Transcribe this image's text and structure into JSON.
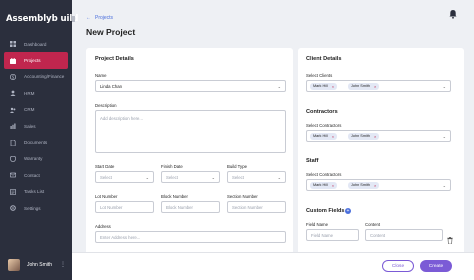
{
  "app": {
    "logo_text": "Assemblyb uild"
  },
  "sidebar": {
    "items": [
      {
        "label": "Dashboard",
        "icon": "dashboard-icon"
      },
      {
        "label": "Projects",
        "icon": "projects-icon",
        "active": true
      },
      {
        "label": "Accounting/Finance",
        "icon": "finance-icon"
      },
      {
        "label": "HRM",
        "icon": "hrm-icon"
      },
      {
        "label": "CRM",
        "icon": "crm-icon"
      },
      {
        "label": "Sales",
        "icon": "sales-icon"
      },
      {
        "label": "Documents",
        "icon": "documents-icon"
      },
      {
        "label": "Warranty",
        "icon": "warranty-icon"
      },
      {
        "label": "Contact",
        "icon": "contact-icon"
      },
      {
        "label": "Tasks List",
        "icon": "tasks-icon"
      },
      {
        "label": "Settings",
        "icon": "settings-icon"
      }
    ],
    "user": {
      "name": "John Smith"
    }
  },
  "header": {
    "breadcrumb": "Projects",
    "title": "New Project"
  },
  "project_details": {
    "title": "Project Details",
    "name_label": "Name",
    "name_value": "Linda Chan",
    "description_label": "Description",
    "description_placeholder": "Add description here...",
    "start_date_label": "Start Date",
    "finish_date_label": "Finish Date",
    "build_type_label": "Build Type",
    "select_placeholder": "Select",
    "lot_number_label": "Lot Number",
    "lot_number_placeholder": "Lot Number",
    "block_number_label": "Block Number",
    "block_number_placeholder": "Block Number",
    "section_number_label": "Section Number",
    "section_number_placeholder": "Section Number",
    "address_label": "Address",
    "address_placeholder": "Enter Address here..."
  },
  "client_details": {
    "title": "Client Details",
    "select_clients_label": "Select Clients",
    "clients": [
      "Mark Hill",
      "John Smith"
    ]
  },
  "contractors": {
    "title": "Contractors",
    "select_label": "Select Contractors",
    "items": [
      "Mark Hill",
      "John Smith"
    ]
  },
  "staff": {
    "title": "Staff",
    "select_label": "Select Contractors",
    "items": [
      "Mark Hill",
      "John Smith"
    ]
  },
  "custom_fields": {
    "title": "Custom Fields",
    "field_name_label": "Field Name",
    "field_name_placeholder": "Field Name",
    "content_label": "Content",
    "content_placeholder": "Content"
  },
  "footer": {
    "close_label": "Close",
    "create_label": "Create"
  },
  "colors": {
    "sidebar_bg": "#2b2f3d",
    "active_item": "#c0264e",
    "primary": "#7b5bd6",
    "link": "#4b6fdc"
  }
}
